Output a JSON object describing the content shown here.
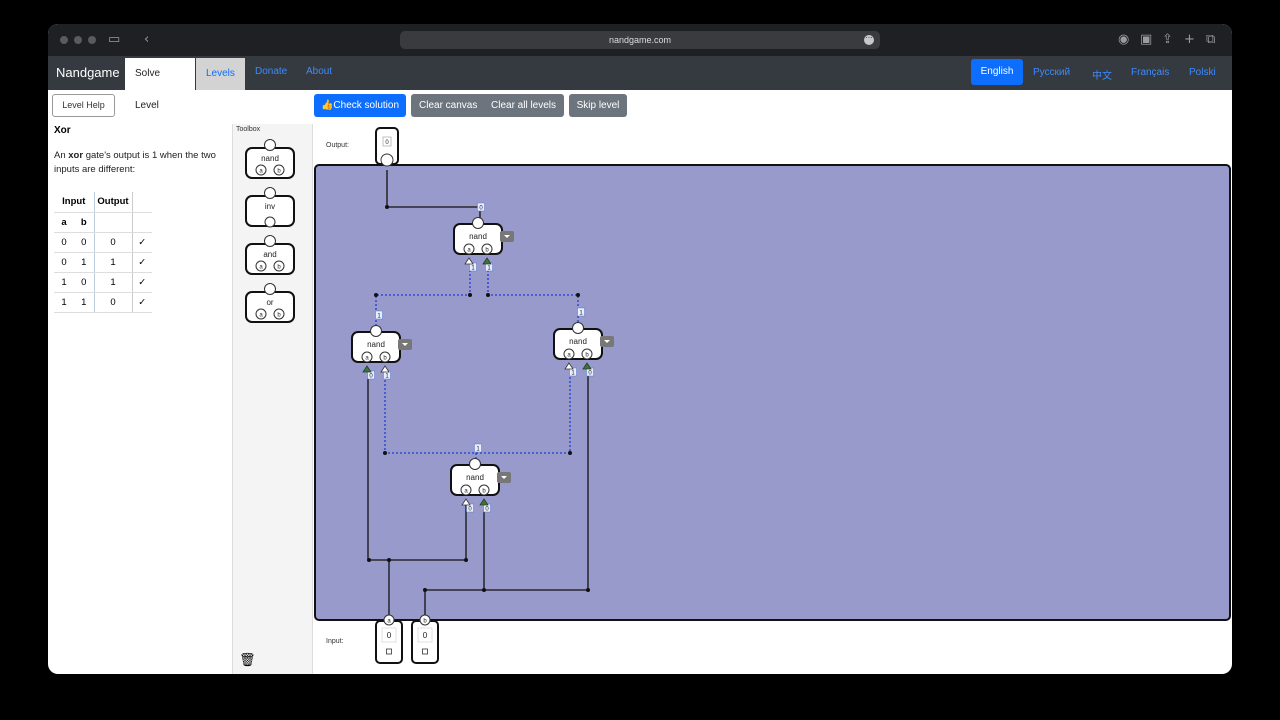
{
  "browser": {
    "url": "nandgame.com"
  },
  "nav": {
    "brand": "Nandgame",
    "tabs": [
      "Solve Level",
      "Levels",
      "Donate",
      "About"
    ],
    "languages": [
      "English",
      "Русский",
      "中文",
      "Français",
      "Polski"
    ]
  },
  "left": {
    "help_button": "Level Help",
    "level_title": "Xor",
    "desc_pre": "An ",
    "desc_bold": "xor",
    "desc_post": " gate's output is 1 when the two inputs are different:",
    "table_head": [
      "Input",
      "Output"
    ],
    "table_sub": [
      "a",
      "b"
    ],
    "rows": [
      {
        "a": "0",
        "b": "0",
        "out": "0",
        "ok": "✓"
      },
      {
        "a": "0",
        "b": "1",
        "out": "1",
        "ok": "✓"
      },
      {
        "a": "1",
        "b": "0",
        "out": "1",
        "ok": "✓"
      },
      {
        "a": "1",
        "b": "1",
        "out": "0",
        "ok": "✓"
      }
    ]
  },
  "toolbox": {
    "title": "Toolbox",
    "items": [
      "nand",
      "inv",
      "and",
      "or"
    ]
  },
  "actions": {
    "check": "Check solution",
    "clear": "Clear canvas",
    "clear_all": "Clear all levels",
    "skip": "Skip level"
  },
  "canvas": {
    "output_label": "Output:",
    "input_label": "Input:",
    "output_value": "0",
    "gate_label": "nand",
    "pin_a": "a",
    "pin_b": "b",
    "input_a_value": "0",
    "input_b_value": "0",
    "wire_values": [
      "0",
      "1",
      "1",
      "1",
      "1",
      "0",
      "1",
      "1",
      "0",
      "1",
      "0",
      "0"
    ]
  },
  "colors": {
    "canvas_bg": "#989acb",
    "primary": "#0d6efd",
    "secondary": "#6c757d",
    "navbar": "#343a40",
    "active_wire": "#1a3fd6",
    "triangle_high": "#2f7d32"
  }
}
